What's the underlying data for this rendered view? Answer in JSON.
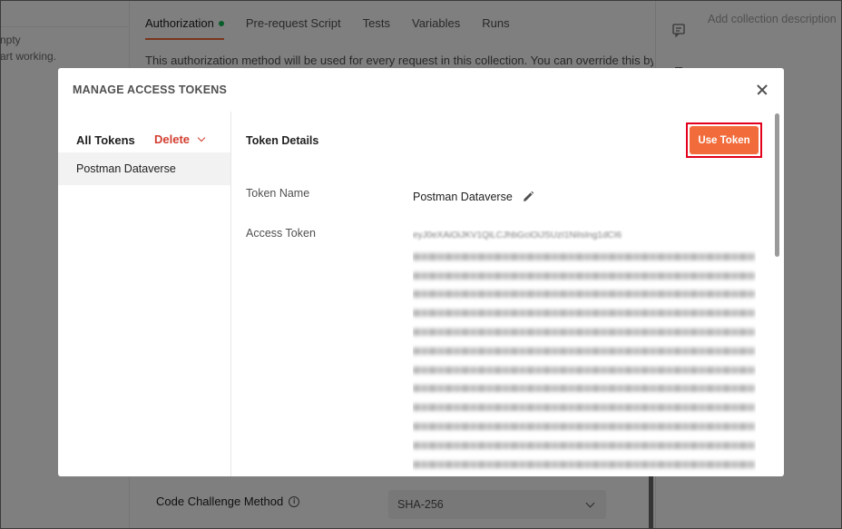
{
  "background": {
    "left_lines": [
      "npty",
      "art working."
    ],
    "tabs": [
      {
        "label": "Authorization",
        "active": true,
        "dot": true
      },
      {
        "label": "Pre-request Script",
        "active": false
      },
      {
        "label": "Tests",
        "active": false
      },
      {
        "label": "Variables",
        "active": false
      },
      {
        "label": "Runs",
        "active": false
      }
    ],
    "info_text": "This authorization method will be used for every request in this collection. You can override this by",
    "description_placeholder": "Add collection description",
    "code_challenge_label": "Code Challenge Method",
    "code_challenge_value": "SHA-256"
  },
  "modal": {
    "title": "MANAGE ACCESS TOKENS",
    "sidebar": {
      "all_tokens_label": "All Tokens",
      "delete_label": "Delete",
      "tokens": [
        "Postman Dataverse"
      ]
    },
    "details": {
      "title": "Token Details",
      "use_token_label": "Use Token",
      "token_name_label": "Token Name",
      "token_name_value": "Postman Dataverse",
      "access_token_label": "Access Token",
      "access_token_value": "eyJ0eXAiOiJKV1QiLCJhbGciOiJSUzI1NiIsIng1dCI6"
    }
  },
  "colors": {
    "accent": "#f26b3a",
    "delete": "#d23f31",
    "highlight_box": "#e3001b",
    "status_dot": "#0cbb52"
  }
}
